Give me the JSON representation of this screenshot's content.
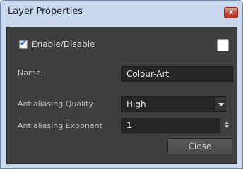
{
  "window": {
    "title": "Layer Properties",
    "close_glyph": "x"
  },
  "enable": {
    "label": "Enable/Disable",
    "checked": true,
    "check_glyph": "✔"
  },
  "color_swatch": {
    "color": "#ffffff"
  },
  "name": {
    "label": "Name:",
    "value": "Colour-Art"
  },
  "antialiasing_quality": {
    "label": "Antialiasing Quality",
    "value": "High"
  },
  "antialiasing_exponent": {
    "label": "Antialiasing Exponent",
    "value": "1"
  },
  "buttons": {
    "close_label": "Close"
  },
  "colors": {
    "panel_bg": "#3f3f3f",
    "field_bg": "#262626",
    "title_bar": "#c7d7ec",
    "close_red": "#c8453a"
  },
  "icons": {
    "close": "close-icon",
    "check": "checkmark-icon",
    "dropdown": "chevron-down-icon",
    "spin": "spinner-arrows-icon"
  }
}
